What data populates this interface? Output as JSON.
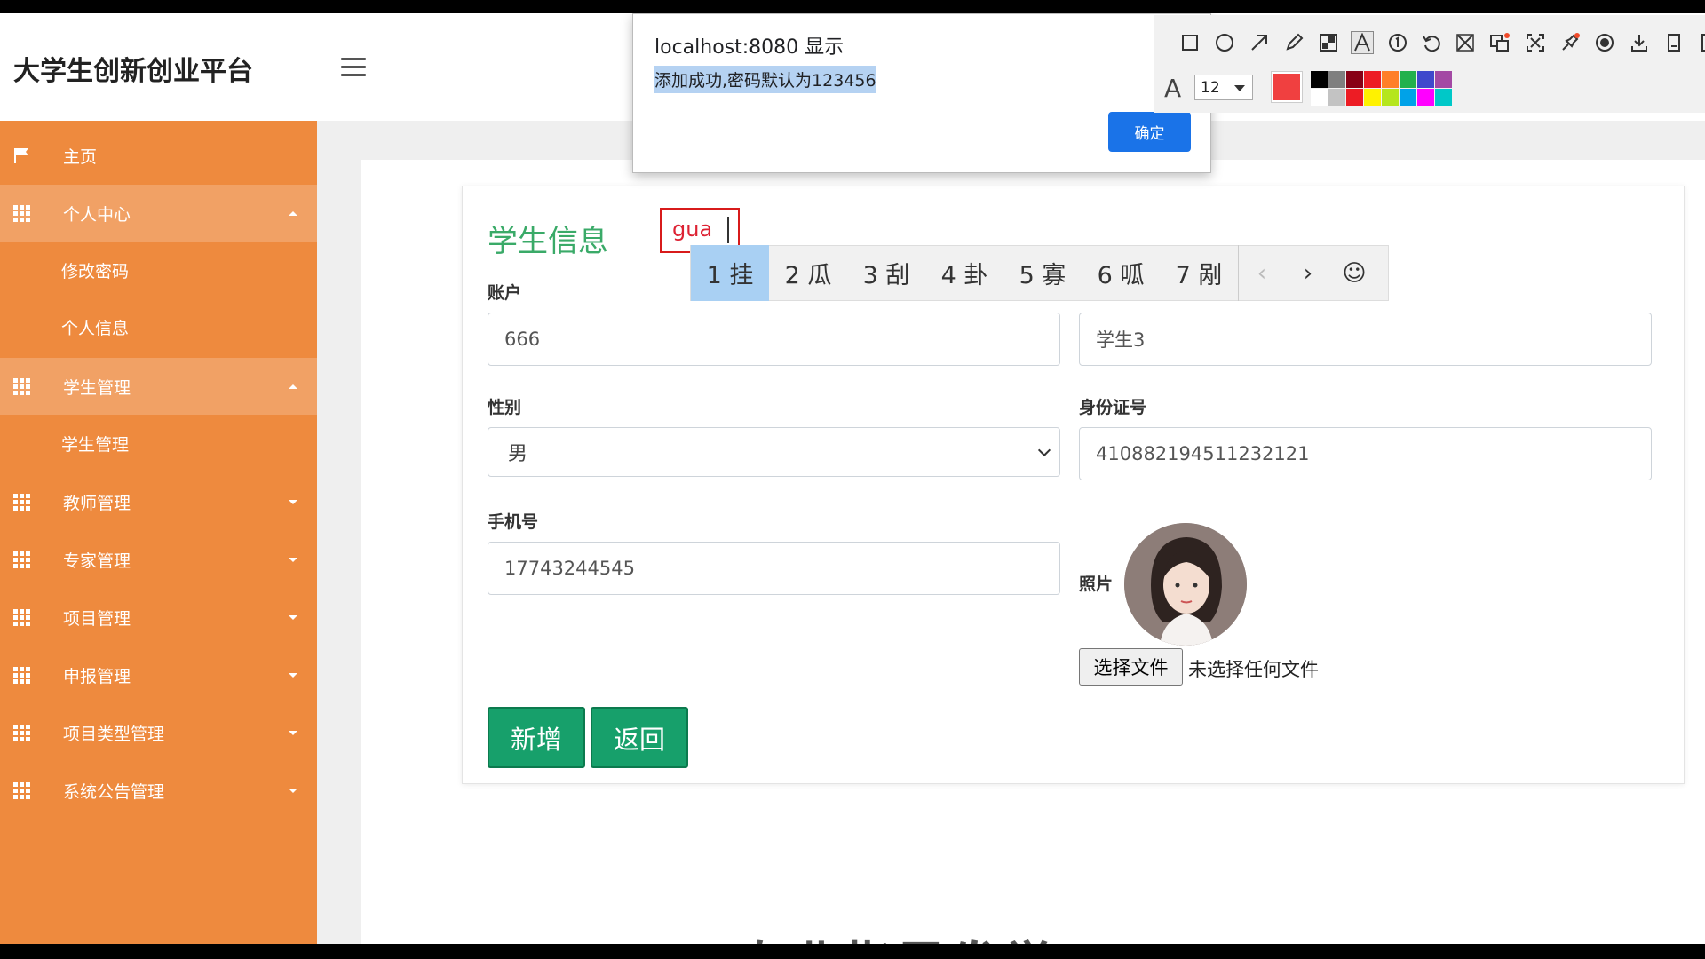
{
  "header": {
    "brand": "大学生创新创业平台"
  },
  "sidebar": {
    "items": [
      {
        "label": "主页"
      },
      {
        "label": "个人中心"
      },
      {
        "label": "修改密码"
      },
      {
        "label": "个人信息"
      },
      {
        "label": "学生管理"
      },
      {
        "label": "学生管理"
      },
      {
        "label": "教师管理"
      },
      {
        "label": "专家管理"
      },
      {
        "label": "项目管理"
      },
      {
        "label": "申报管理"
      },
      {
        "label": "项目类型管理"
      },
      {
        "label": "系统公告管理"
      }
    ]
  },
  "form": {
    "title": "学生信息",
    "account_label": "账户",
    "account_value": "666",
    "name_value": "学生3",
    "gender_label": "性别",
    "gender_value": "男",
    "id_label": "身份证号",
    "id_value": "410882194511232121",
    "phone_label": "手机号",
    "phone_value": "17743244545",
    "photo_label": "照片",
    "file_button": "选择文件",
    "file_status": "未选择任何文件",
    "add_button": "新增",
    "back_button": "返回"
  },
  "ime": {
    "composition": "gua",
    "candidates": [
      "1 挂",
      "2 瓜",
      "3 刮",
      "4 卦",
      "5 寡",
      "6 呱",
      "7 剐"
    ],
    "prev": "‹",
    "next": "›",
    "emoji": "☺"
  },
  "alert": {
    "title": "localhost:8080 显示",
    "message": "添加成功,密码默认为123456",
    "ok_button": "确定"
  },
  "annotation_toolbar": {
    "font_glyph": "A",
    "font_size": "12",
    "current_color": "#f04040",
    "palette": [
      "#000000",
      "#7f7f7f",
      "#880015",
      "#ed1c24",
      "#ff7f27",
      "#22b14c",
      "#3f48cc",
      "#a349a4",
      "#ffffff",
      "#c3c3c3",
      "#ed1c24",
      "#fff200",
      "#b5e61d",
      "#00a2e8",
      "#ff00ff",
      "#00c8c8"
    ],
    "tool_icons": [
      "rectangle-icon",
      "circle-icon",
      "arrow-icon",
      "pencil-icon",
      "mosaic-icon",
      "text-icon",
      "number-icon",
      "undo-icon",
      "cancel-icon",
      "translate-icon",
      "fullscreen-icon",
      "pin-icon",
      "record-icon",
      "download-icon",
      "save-icon",
      "close-icon"
    ]
  },
  "bottom_text": "专业指导发学"
}
